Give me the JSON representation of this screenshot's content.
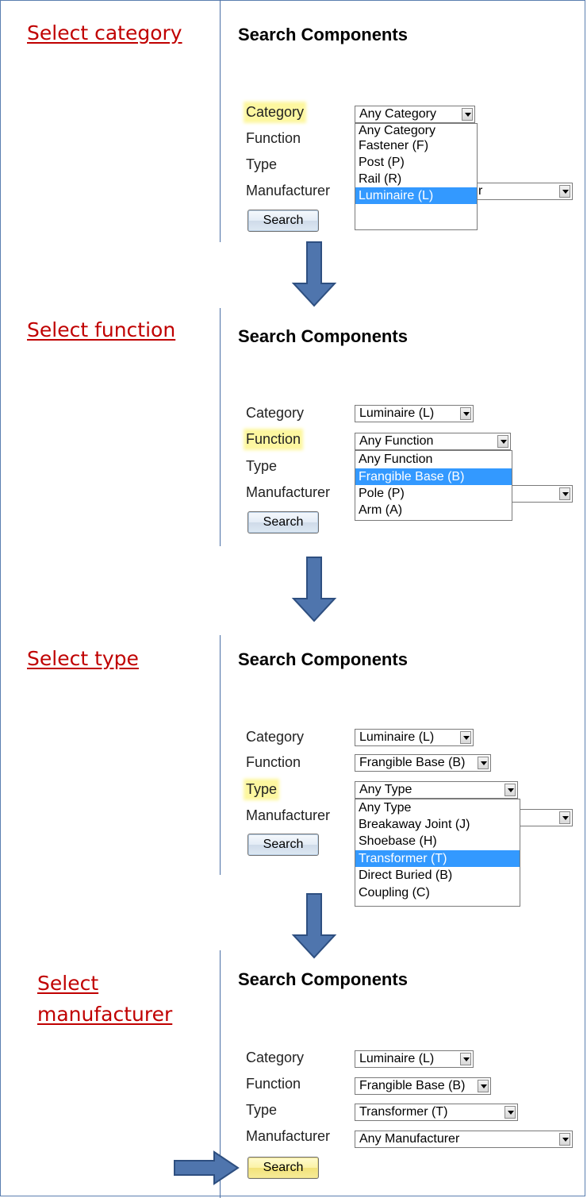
{
  "steps": [
    {
      "label": "Select category",
      "title": "Search Components",
      "fields": {
        "category": {
          "label": "Category",
          "value": "Any Category"
        },
        "function": {
          "label": "Function"
        },
        "type": {
          "label": "Type"
        },
        "manufacturer": {
          "label": "Manufacturer",
          "value": "r"
        }
      },
      "highlighted": "Category",
      "open_dropdown": {
        "field": "Category",
        "options": [
          "Any Category",
          "Fastener (F)",
          "Post (P)",
          "Rail (R)",
          "Luminaire (L)"
        ],
        "selected": "Luminaire (L)"
      },
      "button": "Search"
    },
    {
      "label": "Select function",
      "title": "Search Components",
      "fields": {
        "category": {
          "label": "Category",
          "value": "Luminaire (L)"
        },
        "function": {
          "label": "Function",
          "value": "Any Function"
        },
        "type": {
          "label": "Type"
        },
        "manufacturer": {
          "label": "Manufacturer"
        }
      },
      "highlighted": "Function",
      "open_dropdown": {
        "field": "Function",
        "options": [
          "Any Function",
          "Frangible Base (B)",
          "Pole (P)",
          "Arm (A)"
        ],
        "selected": "Frangible Base (B)"
      },
      "button": "Search"
    },
    {
      "label": "Select type",
      "title": "Search Components",
      "fields": {
        "category": {
          "label": "Category",
          "value": "Luminaire (L)"
        },
        "function": {
          "label": "Function",
          "value": "Frangible Base (B)"
        },
        "type": {
          "label": "Type",
          "value": "Any Type"
        },
        "manufacturer": {
          "label": "Manufacturer"
        }
      },
      "highlighted": "Type",
      "open_dropdown": {
        "field": "Type",
        "options": [
          "Any Type",
          "Breakaway Joint (J)",
          "Shoebase (H)",
          "Transformer (T)",
          "Direct Buried (B)",
          "Coupling (C)"
        ],
        "selected": "Transformer (T)"
      },
      "button": "Search"
    },
    {
      "label_line1": "Select",
      "label_line2": "manufacturer",
      "title": "Search Components",
      "fields": {
        "category": {
          "label": "Category",
          "value": "Luminaire (L)"
        },
        "function": {
          "label": "Function",
          "value": "Frangible Base (B)"
        },
        "type": {
          "label": "Type",
          "value": "Transformer (T)"
        },
        "manufacturer": {
          "label": "Manufacturer",
          "value": "Any Manufacturer"
        }
      },
      "button": "Search"
    }
  ],
  "colors": {
    "step_label": "#c00000",
    "highlight": "#fdf7a0",
    "selected_option": "#3399ff",
    "arrow_fill": "#4f75ad",
    "divider": "#4a6fa5"
  },
  "icons": [
    "down-arrow-icon",
    "right-arrow-icon",
    "dropdown-arrow-icon"
  ]
}
